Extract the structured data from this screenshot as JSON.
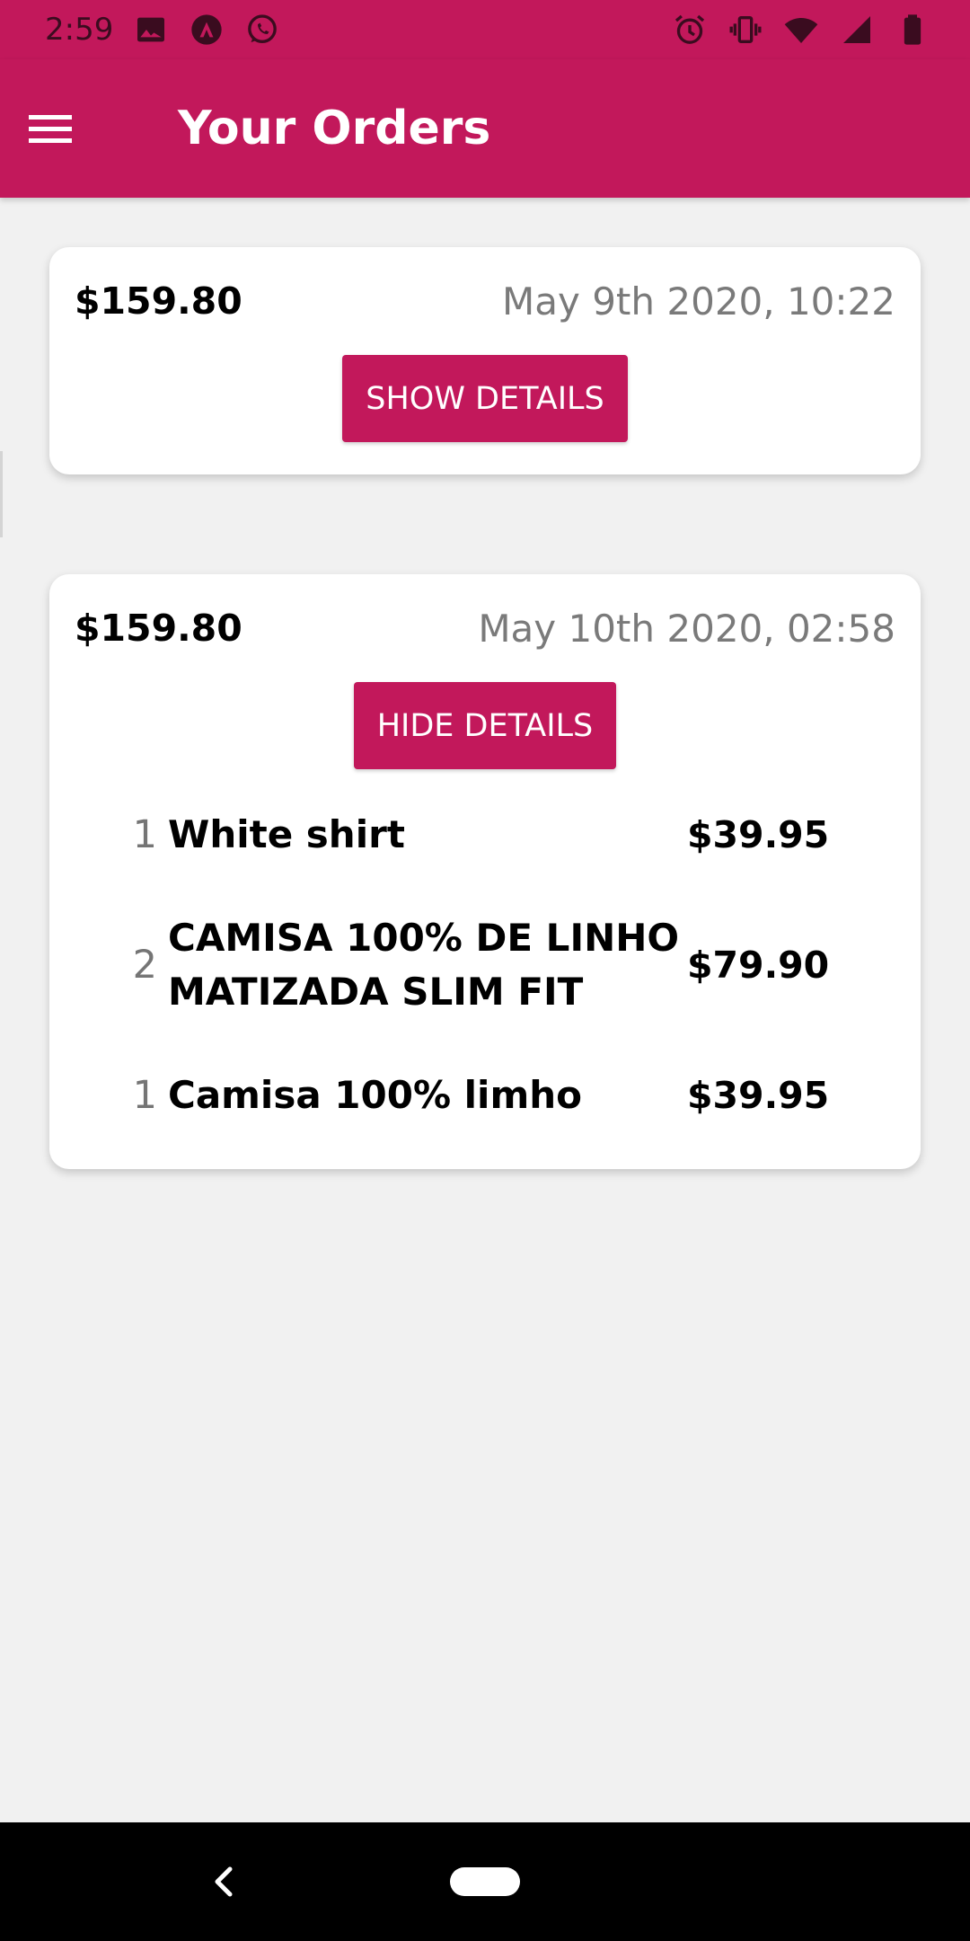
{
  "status_bar": {
    "time": "2:59",
    "left_icons": [
      "image-icon",
      "app-a-icon",
      "whatsapp-icon"
    ],
    "right_icons": [
      "alarm-icon",
      "vibrate-icon",
      "wifi-icon",
      "signal-icon",
      "battery-icon"
    ]
  },
  "app_bar": {
    "title": "Your Orders",
    "menu_icon": "hamburger-menu-icon"
  },
  "colors": {
    "primary": "#c2185b",
    "background": "#f1f1f1",
    "card": "#ffffff",
    "date_text": "#7a7a7a"
  },
  "orders": [
    {
      "amount": "$159.80",
      "date": "May 9th 2020, 10:22",
      "button_label": "SHOW DETAILS",
      "expanded": false,
      "items": []
    },
    {
      "amount": "$159.80",
      "date": "May 10th 2020, 02:58",
      "button_label": "HIDE DETAILS",
      "expanded": true,
      "items": [
        {
          "qty": "1",
          "name": "White shirt",
          "price": "$39.95"
        },
        {
          "qty": "2",
          "name": "CAMISA 100% DE LINHO MATIZADA SLIM FIT",
          "price": "$79.90"
        },
        {
          "qty": "1",
          "name": "Camisa 100% limho",
          "price": "$39.95"
        }
      ]
    }
  ],
  "nav_bar": {
    "back_icon": "back-chevron-icon",
    "home_icon": "home-pill-icon"
  }
}
